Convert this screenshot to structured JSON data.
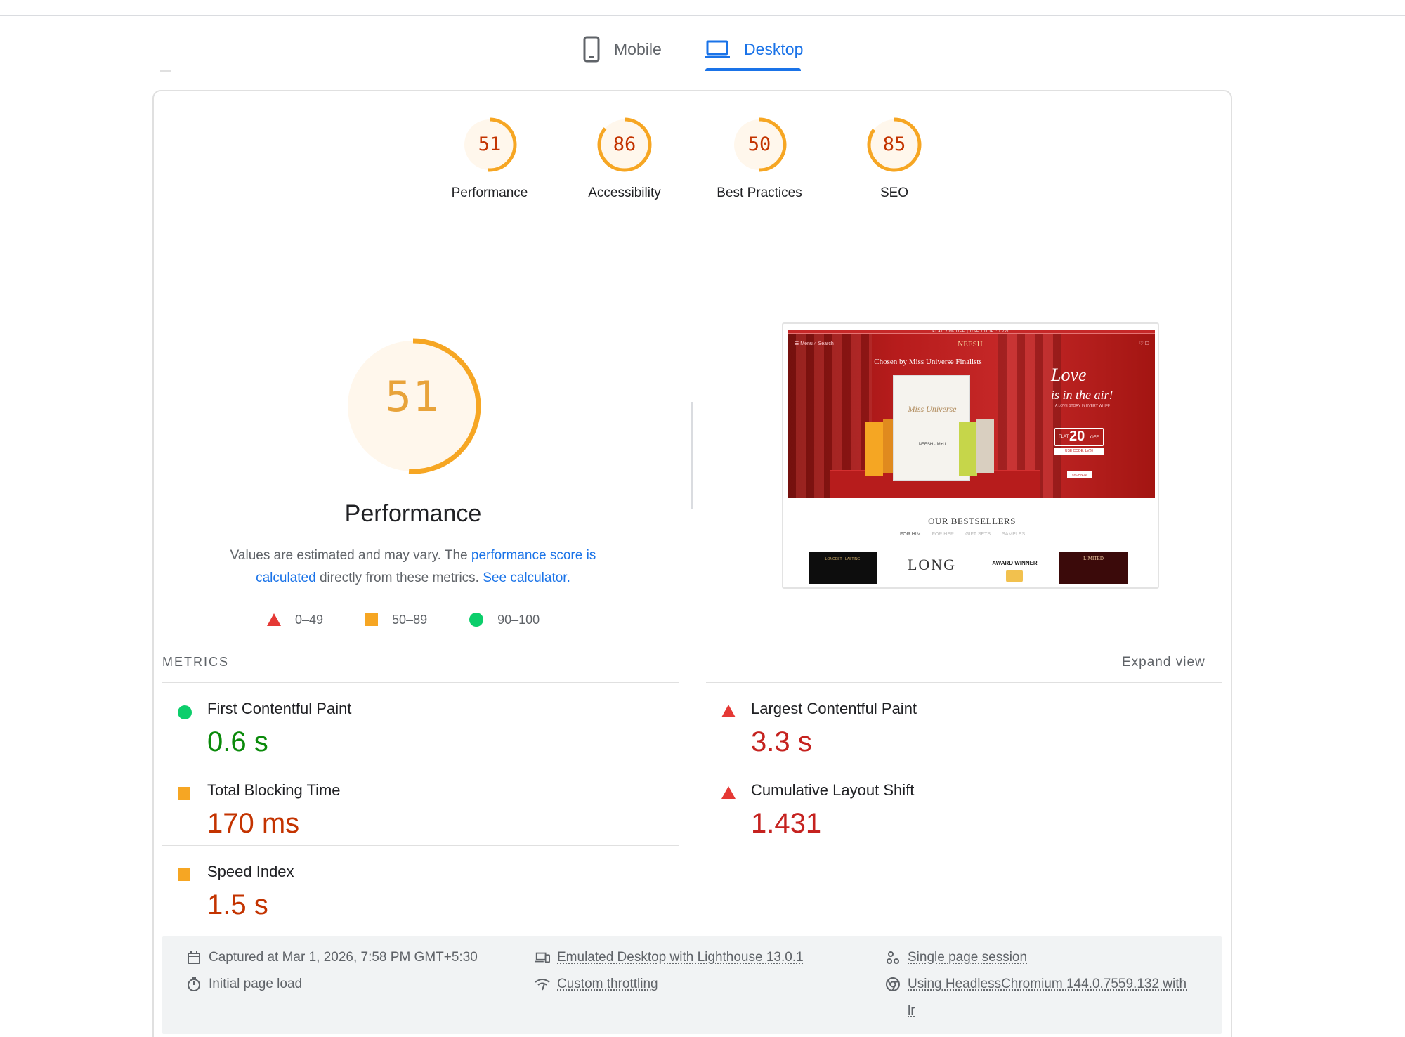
{
  "tabs": {
    "mobile": "Mobile",
    "desktop": "Desktop",
    "active": "desktop"
  },
  "categories": [
    {
      "label": "Performance",
      "score": "51",
      "value": 0.51
    },
    {
      "label": "Accessibility",
      "score": "86",
      "value": 0.86
    },
    {
      "label": "Best Practices",
      "score": "50",
      "value": 0.5
    },
    {
      "label": "SEO",
      "score": "85",
      "value": 0.85
    }
  ],
  "performance": {
    "score": "51",
    "value": 0.51,
    "title": "Performance",
    "desc_prefix": "Values are estimated and may vary. The ",
    "link_score": "performance score is calculated",
    "desc_middle": " directly from these metrics. ",
    "link_calculator": "See calculator.",
    "legend": {
      "low": "0–49",
      "mid": "50–89",
      "high": "90–100"
    }
  },
  "screenshot": {
    "banner": "FLAT 20% OFF | USE CODE : LV20",
    "menu": "Menu",
    "search": "Search",
    "brand": "NEESH",
    "tagline": "Chosen by Miss Universe Finalists",
    "box_title": "Miss Universe",
    "box_brand": "NEESH · M+U",
    "love_line1": "Love",
    "love_line2": "is in the air!",
    "love_sub": "A LOVE STORY IN EVERY WHIFF",
    "flat": "FLAT",
    "flat_num": "20",
    "off": "OFF",
    "code": "USE CODE: LV20",
    "shop": "SHOP NOW",
    "bestsellers": "OUR BESTSELLERS",
    "best_tabs": [
      "FOR HIM",
      "FOR HER",
      "GIFT SETS",
      "SAMPLES"
    ],
    "prod1": "LONGEST · LASTING",
    "prod2": "LONG",
    "prod3": "AWARD WINNER",
    "prod4": "LIMITED"
  },
  "metrics": {
    "header": "METRICS",
    "expand": "Expand view",
    "items": [
      {
        "name": "First Contentful Paint",
        "value": "0.6 s",
        "rating": "good"
      },
      {
        "name": "Largest Contentful Paint",
        "value": "3.3 s",
        "rating": "poor"
      },
      {
        "name": "Total Blocking Time",
        "value": "170 ms",
        "rating": "average"
      },
      {
        "name": "Cumulative Layout Shift",
        "value": "1.431",
        "rating": "poor"
      },
      {
        "name": "Speed Index",
        "value": "1.5 s",
        "rating": "average"
      }
    ]
  },
  "info": {
    "captured": "Captured at Mar 1, 2026, 7:58 PM GMT+5:30",
    "initial": "Initial page load",
    "emulated": "Emulated Desktop with Lighthouse 13.0.1",
    "throttling": "Custom throttling",
    "session": "Single page session",
    "browser_line1": "Using HeadlessChromium 144.0.7559.132 with",
    "browser_line2": "lr"
  },
  "colors": {
    "accent": "#1a73e8",
    "average": "#f6a623",
    "poor": "#e53935",
    "good": "#0cce6b",
    "gauge_text": "#c33300",
    "gauge_fill": "#fff7ec"
  }
}
